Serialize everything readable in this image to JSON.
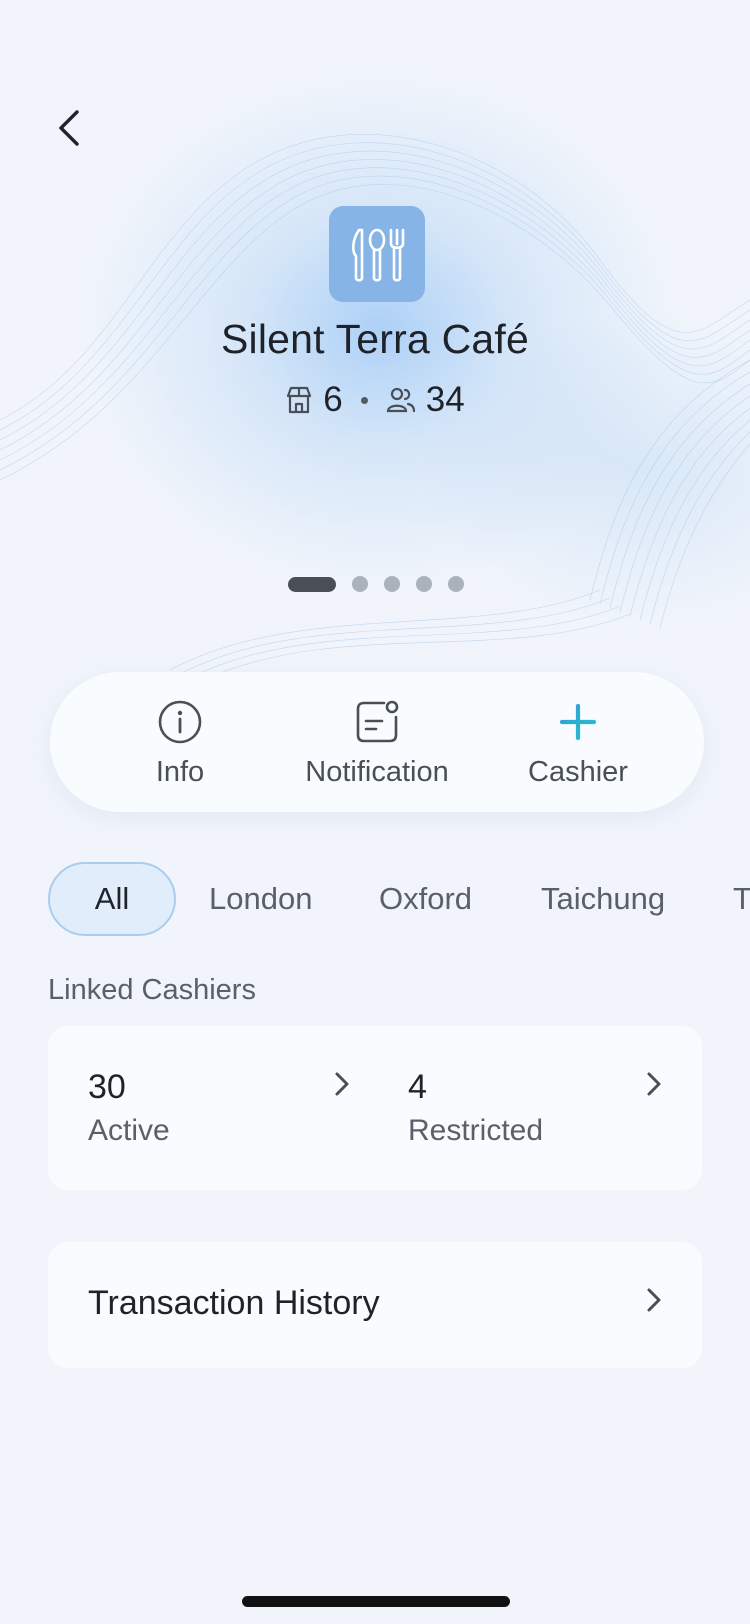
{
  "store": {
    "name": "Silent Terra Café",
    "branches_count": "6",
    "members_count": "34",
    "icon": "utensils-icon"
  },
  "pager": {
    "total": 5,
    "current": 1
  },
  "actions": [
    {
      "label": "Info",
      "icon": "info-icon"
    },
    {
      "label": "Notification",
      "icon": "notification-icon"
    },
    {
      "label": "Cashier",
      "icon": "plus-icon"
    }
  ],
  "filters": {
    "chips": [
      "All",
      "London",
      "Oxford",
      "Taichung",
      "T"
    ],
    "selected": "All"
  },
  "linked_cashiers": {
    "title": "Linked Cashiers",
    "active_count": "30",
    "active_label": "Active",
    "restricted_count": "4",
    "restricted_label": "Restricted"
  },
  "transaction_history": {
    "label": "Transaction History"
  },
  "colors": {
    "background": "#f1f5fb",
    "app_icon_bg": "#86b4e6",
    "chip_active_bg": "#e1edfb",
    "chip_active_border": "#a9cdee",
    "plus_gradient_start": "#2f9ed9",
    "plus_gradient_end": "#27c2c8"
  }
}
